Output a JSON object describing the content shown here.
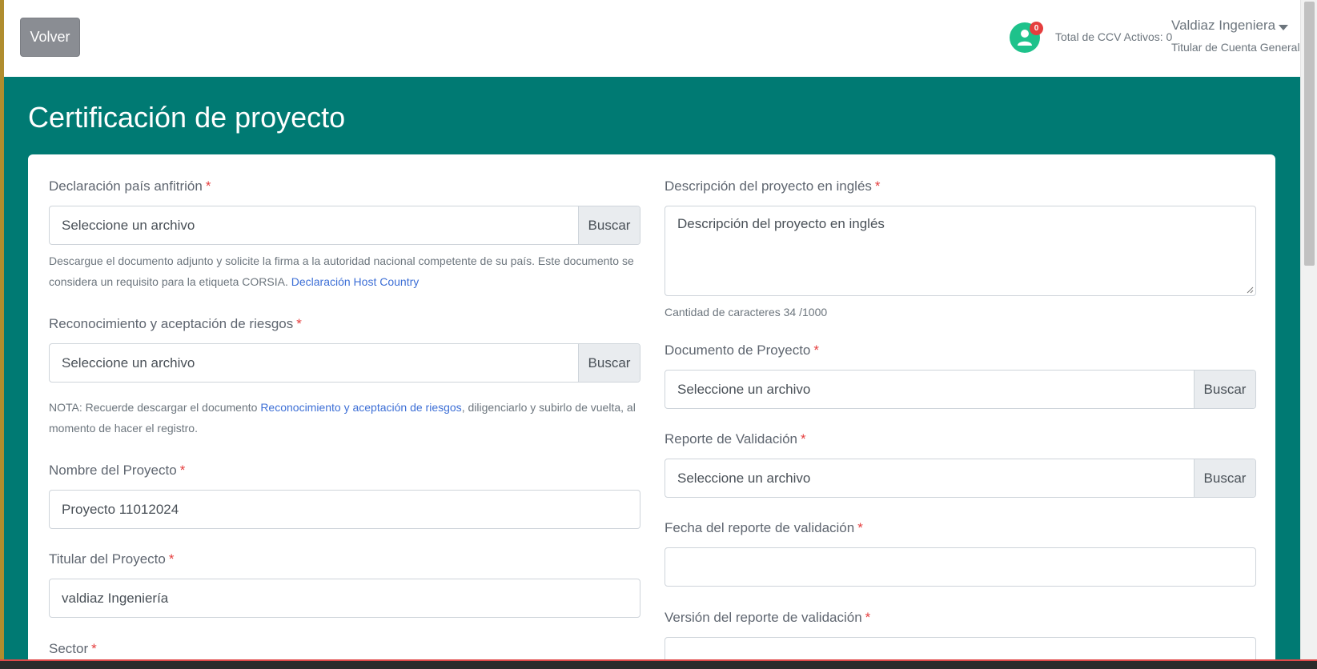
{
  "header": {
    "back_label": "Volver",
    "notifications_count": "0",
    "ccv_total": "Total de CCV Activos: 0",
    "user_name": "Valdiaz Ingeniera",
    "user_role": "Titular de Cuenta General"
  },
  "page": {
    "title": "Certificación de proyecto"
  },
  "form": {
    "required_mark": "*",
    "browse_label": "Buscar",
    "file_placeholder": "Seleccione un archivo",
    "host_country": {
      "label": "Declaración país anfitrión",
      "help_text": "Descargue el documento adjunto y solicite la firma a la autoridad nacional competente de su país. Este documento se considera un requisito para la etiqueta CORSIA.",
      "help_link": "Declaración Host Country"
    },
    "risk_ack": {
      "label": "Reconocimiento y aceptación de riesgos",
      "note_prefix": "NOTA: Recuerde descargar el documento",
      "note_link": "Reconocimiento y aceptación de riesgos",
      "note_suffix": ", diligenciarlo y subirlo de vuelta, al momento de hacer el registro."
    },
    "project_name": {
      "label": "Nombre del Proyecto",
      "value": "Proyecto 11012024"
    },
    "project_holder": {
      "label": "Titular del Proyecto",
      "value": "valdiaz Ingeniería"
    },
    "sector": {
      "label": "Sector"
    },
    "description_en": {
      "label": "Descripción del proyecto en inglés",
      "value": "Descripción del proyecto en inglés",
      "char_count": "Cantidad de caracteres 34 /1000"
    },
    "project_document": {
      "label": "Documento de Proyecto"
    },
    "validation_report": {
      "label": "Reporte de Validación"
    },
    "validation_date": {
      "label": "Fecha del reporte de validación",
      "value": ""
    },
    "validation_version": {
      "label": "Versión del reporte de validación",
      "value": ""
    }
  },
  "colors": {
    "teal": "#007a73",
    "accent_link": "#3d6fd6",
    "required": "#e53e3e",
    "avatar": "#1ec28b"
  }
}
